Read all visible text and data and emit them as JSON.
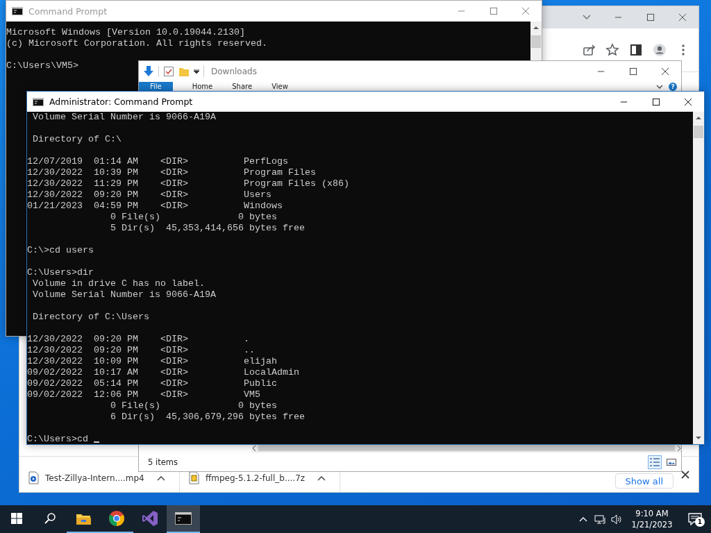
{
  "browser": {
    "downloads_bar": {
      "items": [
        {
          "name": "Test-Zillya-Intern....mp4",
          "kind": "video"
        },
        {
          "name": "ffmpeg-5.1.2-full_b....7z",
          "kind": "archive"
        }
      ],
      "show_all": "Show all"
    }
  },
  "command_prompt": {
    "title": "Command Prompt",
    "active": false,
    "blocks": [
      [
        "Microsoft Windows [Version 10.0.19044.2130]",
        "(c) Microsoft Corporation. All rights reserved."
      ],
      [
        "C:\\Users\\VM5>"
      ]
    ]
  },
  "explorer": {
    "title": "Downloads",
    "ribbon_tabs": [
      {
        "label": "File",
        "kind": "menu"
      },
      {
        "label": "Home",
        "kind": "tab"
      },
      {
        "label": "Share",
        "kind": "tab"
      },
      {
        "label": "View",
        "kind": "tab"
      }
    ],
    "help": "?",
    "status": "5 items",
    "view_buttons": [
      {
        "kind": "details",
        "selected": true
      },
      {
        "kind": "thumbnails",
        "selected": false
      }
    ]
  },
  "admin_prompt": {
    "title": "Administrator: Command Prompt",
    "active": true,
    "cursor": true,
    "blocks": [
      [
        " Volume Serial Number is 9066-A19A"
      ],
      [
        " Directory of C:\\"
      ],
      [
        "12/07/2019  01:14 AM    <DIR>          PerfLogs",
        "12/30/2022  10:39 PM    <DIR>          Program Files",
        "12/30/2022  11:29 PM    <DIR>          Program Files (x86)",
        "12/30/2022  09:20 PM    <DIR>          Users",
        "01/21/2023  04:59 PM    <DIR>          Windows",
        "               0 File(s)              0 bytes",
        "               5 Dir(s)  45,353,414,656 bytes free"
      ],
      [
        "C:\\>cd users"
      ],
      [
        "C:\\Users>dir",
        " Volume in drive C has no label.",
        " Volume Serial Number is 9066-A19A"
      ],
      [
        " Directory of C:\\Users"
      ],
      [
        "12/30/2022  09:20 PM    <DIR>          .",
        "12/30/2022  09:20 PM    <DIR>          ..",
        "12/30/2022  10:09 PM    <DIR>          elijah",
        "09/02/2022  10:17 AM    <DIR>          LocalAdmin",
        "09/02/2022  05:14 PM    <DIR>          Public",
        "09/02/2022  12:06 PM    <DIR>          VM5",
        "               0 File(s)              0 bytes",
        "               6 Dir(s)  45,306,679,296 bytes free"
      ],
      [
        "C:\\Users>cd"
      ]
    ]
  },
  "taskbar": {
    "apps": [
      {
        "kind": "start",
        "running": false,
        "selected": false
      },
      {
        "kind": "search",
        "running": false,
        "selected": false
      },
      {
        "kind": "explorer",
        "running": true,
        "selected": false
      },
      {
        "kind": "chrome",
        "running": true,
        "selected": false
      },
      {
        "kind": "studio",
        "running": false,
        "selected": false
      },
      {
        "kind": "terminal",
        "running": true,
        "selected": true
      }
    ],
    "clock": {
      "time": "9:10 AM",
      "date": "1/21/2023"
    },
    "notifications": "1"
  }
}
